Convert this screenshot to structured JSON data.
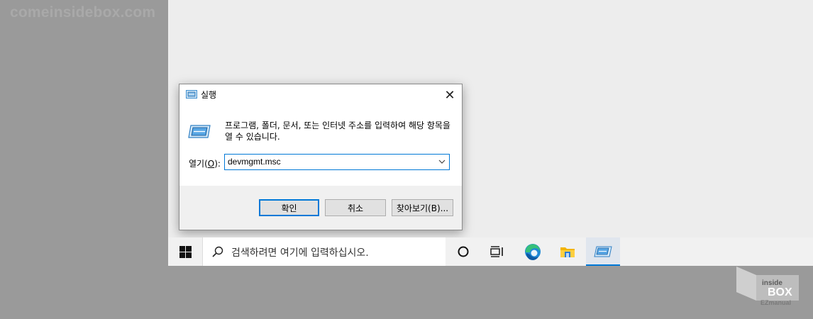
{
  "watermark": "comeinsidebox.com",
  "dialog": {
    "title": "실행",
    "close_glyph": "✕",
    "description": "프로그램, 폴더, 문서, 또는 인터넷 주소를 입력하여 해당 항목을 열 수 있습니다.",
    "open_label_prefix": "열기(",
    "open_label_key": "O",
    "open_label_suffix": "):",
    "open_value": "devmgmt.msc",
    "ok_label": "확인",
    "cancel_label": "취소",
    "browse_label": "찾아보기(B)..."
  },
  "taskbar": {
    "search_placeholder": "검색하려면 여기에 입력하십시오.",
    "icons": [
      "windows-start-icon",
      "cortana-icon",
      "task-view-icon",
      "edge-icon",
      "file-explorer-icon",
      "run-icon"
    ]
  },
  "logo": {
    "line1": "inside",
    "line2": "BOX",
    "line3": "EZmanual"
  },
  "colors": {
    "accent": "#0078d7",
    "background": "#9a9a9a",
    "desktop": "#ededed",
    "taskbar": "#f1f1f1"
  }
}
